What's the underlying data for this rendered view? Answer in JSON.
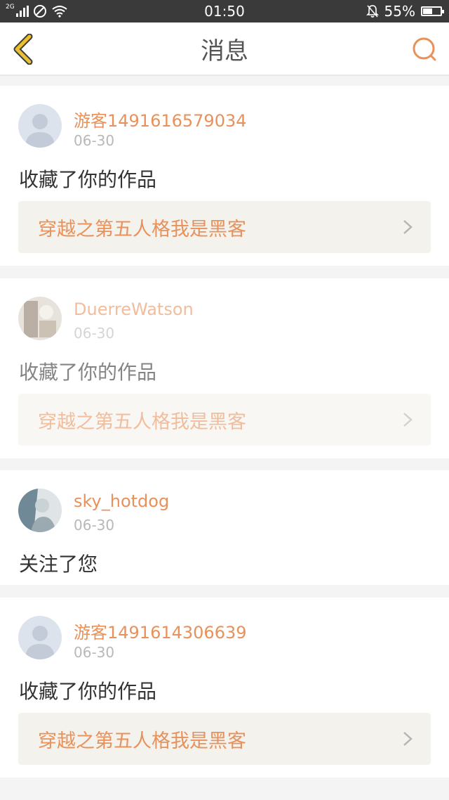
{
  "status_bar": {
    "network_badge": "2G",
    "time": "01:50",
    "battery_percent": "55%",
    "battery_level": 0.55
  },
  "nav": {
    "title": "消息",
    "back_icon": "chevron-left-icon",
    "search_icon": "search-icon"
  },
  "colors": {
    "accent": "#e8915a",
    "back_icon": "#e8c030",
    "text_primary": "#333333",
    "text_muted": "#b8b8b8",
    "card_link_bg": "#f3f2ed"
  },
  "messages": [
    {
      "username": "游客1491616579034",
      "date": "06-30",
      "action": "收藏了你的作品",
      "work_title": "穿越之第五人格我是黑客",
      "avatar": "default-avatar"
    },
    {
      "username": "DuerreWatson",
      "date": "06-30",
      "action": "收藏了你的作品",
      "work_title": "穿越之第五人格我是黑客",
      "avatar": "photo-avatar"
    },
    {
      "username": "sky_hotdog",
      "date": "06-30",
      "action": "关注了您",
      "avatar": "photo-avatar"
    },
    {
      "username": "游客1491614306639",
      "date": "06-30",
      "action": "收藏了你的作品",
      "work_title": "穿越之第五人格我是黑客",
      "avatar": "default-avatar"
    }
  ]
}
